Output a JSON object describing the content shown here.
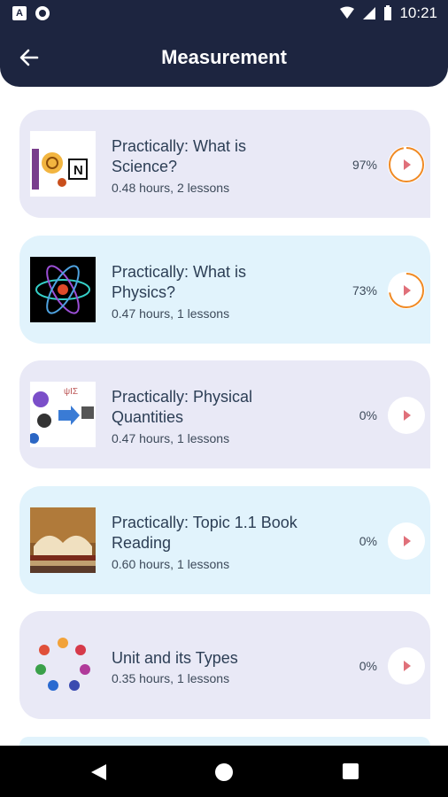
{
  "status_bar": {
    "time": "10:21"
  },
  "header": {
    "title": "Measurement",
    "back_icon": "arrow-left-icon"
  },
  "colors": {
    "header": "#1d2540",
    "card_lavender": "#e9e9f6",
    "card_blue": "#e1f3fc",
    "progress": "#f08a24",
    "play": "#e0707a"
  },
  "courses": [
    {
      "title": "Practically: What is Science?",
      "meta": "0.48 hours, 2 lessons",
      "percent_label": "97%",
      "progress": 0.97,
      "thumb": "science-thumbnail"
    },
    {
      "title": "Practically: What is Physics?",
      "meta": "0.47 hours, 1 lessons",
      "percent_label": "73%",
      "progress": 0.73,
      "thumb": "physics-atom-thumbnail"
    },
    {
      "title": "Practically: Physical Quantities",
      "meta": "0.47 hours, 1 lessons",
      "percent_label": "0%",
      "progress": 0,
      "thumb": "physical-quantities-thumbnail"
    },
    {
      "title": "Practically: Topic 1.1  Book Reading",
      "meta": "0.60 hours, 1 lessons",
      "percent_label": "0%",
      "progress": 0,
      "thumb": "book-thumbnail"
    },
    {
      "title": "Unit and its Types",
      "meta": "0.35 hours, 1 lessons",
      "percent_label": "0%",
      "progress": 0,
      "thumb": "units-circle-thumbnail"
    }
  ],
  "nav": {
    "back_icon": "triangle-back-icon",
    "home_icon": "circle-home-icon",
    "recents_icon": "square-recents-icon"
  }
}
